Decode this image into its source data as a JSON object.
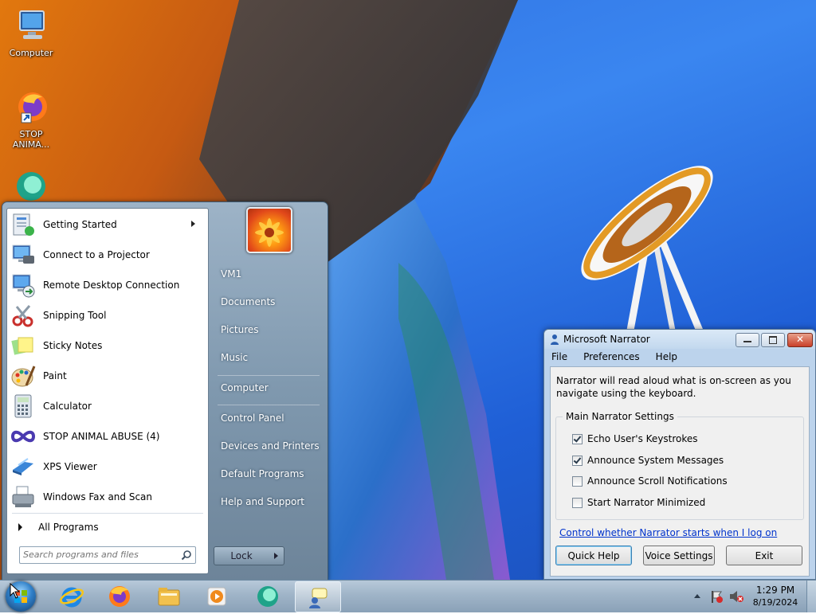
{
  "desktop": {
    "icons": [
      {
        "label": "Computer"
      },
      {
        "label_line1": "STOP",
        "label_line2": "ANIMA..."
      }
    ]
  },
  "start_menu": {
    "programs": [
      {
        "label": "Getting Started",
        "has_submenu": true
      },
      {
        "label": "Connect to a Projector"
      },
      {
        "label": "Remote Desktop Connection"
      },
      {
        "label": "Snipping Tool"
      },
      {
        "label": "Sticky Notes"
      },
      {
        "label": "Paint"
      },
      {
        "label": "Calculator"
      },
      {
        "label": "STOP ANIMAL ABUSE (4)"
      },
      {
        "label": "XPS Viewer"
      },
      {
        "label": "Windows Fax and Scan"
      }
    ],
    "all_programs": "All Programs",
    "search_placeholder": "Search programs and files",
    "right_items": [
      {
        "label": "VM1"
      },
      {
        "label": "Documents"
      },
      {
        "label": "Pictures"
      },
      {
        "label": "Music"
      },
      {
        "label": "Computer"
      },
      {
        "label": "Control Panel"
      },
      {
        "label": "Devices and Printers"
      },
      {
        "label": "Default Programs"
      },
      {
        "label": "Help and Support"
      }
    ],
    "lock_label": "Lock"
  },
  "narrator": {
    "title": "Microsoft Narrator",
    "menu": [
      "File",
      "Preferences",
      "Help"
    ],
    "description": "Narrator will read aloud what is on-screen as you navigate using the keyboard.",
    "group_title": "Main Narrator Settings",
    "options": [
      {
        "label": "Echo User's Keystrokes",
        "checked": true
      },
      {
        "label": "Announce System Messages",
        "checked": true
      },
      {
        "label": "Announce Scroll Notifications",
        "checked": false
      },
      {
        "label": "Start Narrator Minimized",
        "checked": false
      }
    ],
    "link": "Control whether Narrator starts when I log on",
    "buttons": {
      "quick_help": "Quick Help",
      "voice_settings": "Voice Settings",
      "exit": "Exit"
    }
  },
  "taskbar": {
    "clock_time": "1:29 PM",
    "clock_date": "8/19/2024"
  }
}
